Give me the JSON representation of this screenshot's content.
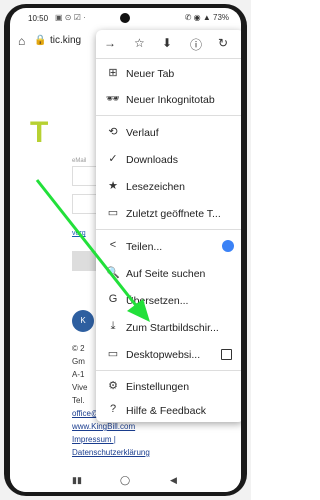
{
  "status_bar": {
    "time": "10:50",
    "left_icons": "▣ ⊙ ☑ ·",
    "right_icons": "✆ ◉ ▲ 73%"
  },
  "address_bar": {
    "url": "tic.king"
  },
  "page": {
    "email_label": "eMail",
    "verg_link": "verg",
    "footer": [
      "© 2",
      "Gm",
      "A-1",
      "Vive",
      "Tel."
    ],
    "footer_links": [
      "office@KingBill.com |",
      "www.KingBill.com",
      "Impressum |",
      "Datenschutzerklärung"
    ]
  },
  "menu": {
    "top_icons": [
      "forward-icon",
      "star-icon",
      "download-icon",
      "info-icon",
      "refresh-icon"
    ],
    "items": [
      {
        "label": "Neuer Tab",
        "icon": "⊞"
      },
      {
        "label": "Neuer Inkognitotab",
        "icon": "🕶"
      },
      {
        "label": "Verlauf",
        "icon": "⟲"
      },
      {
        "label": "Downloads",
        "icon": "✓"
      },
      {
        "label": "Lesezeichen",
        "icon": "★"
      },
      {
        "label": "Zuletzt geöffnete T...",
        "icon": "▭"
      },
      {
        "label": "Teilen...",
        "icon": "<"
      },
      {
        "label": "Auf Seite suchen",
        "icon": "🔍"
      },
      {
        "label": "Übersetzen...",
        "icon": "G"
      },
      {
        "label": "Zum Startbildschir...",
        "icon": "⤓"
      },
      {
        "label": "Desktopwebsi...",
        "icon": "▭"
      },
      {
        "label": "Einstellungen",
        "icon": "⚙"
      },
      {
        "label": "Hilfe & Feedback",
        "icon": "?"
      }
    ]
  },
  "accent_color": "#22e03a"
}
